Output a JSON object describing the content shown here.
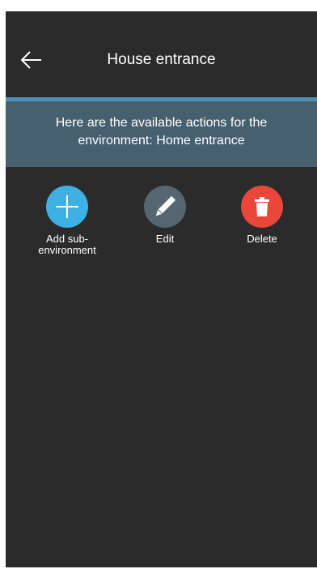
{
  "header": {
    "title": "House entrance",
    "back_icon": "arrow-left-icon"
  },
  "banner": {
    "text": "Here are the available actions for the environment: Home entrance"
  },
  "actions": [
    {
      "label": "Add sub-environment",
      "icon": "plus-icon",
      "color": "#3eb0e4"
    },
    {
      "label": "Edit",
      "icon": "pencil-icon",
      "color": "#556671"
    },
    {
      "label": "Delete",
      "icon": "trash-icon",
      "color": "#e8473a"
    }
  ],
  "colors": {
    "background": "#2b2b2b",
    "banner": "#47606f",
    "banner_accent": "#4a93b8"
  }
}
